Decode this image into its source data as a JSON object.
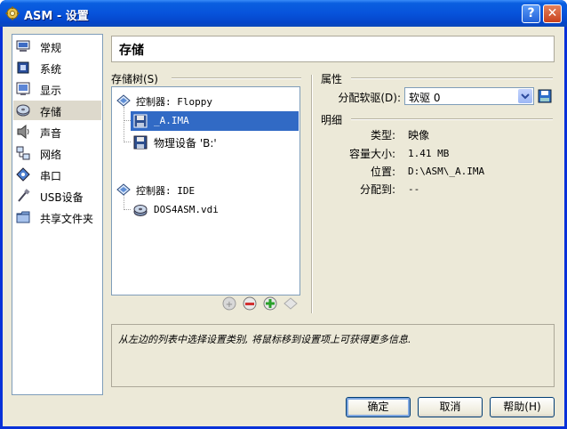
{
  "window": {
    "title": "ASM - 设置"
  },
  "titlebar_buttons": {
    "help": "?",
    "close": "✕"
  },
  "nav": {
    "items": [
      {
        "label": "常规",
        "icon": "monitor-icon"
      },
      {
        "label": "系统",
        "icon": "chip-icon"
      },
      {
        "label": "显示",
        "icon": "display-icon"
      },
      {
        "label": "存储",
        "icon": "disk-icon",
        "selected": true
      },
      {
        "label": "声音",
        "icon": "speaker-icon"
      },
      {
        "label": "网络",
        "icon": "network-icon"
      },
      {
        "label": "串口",
        "icon": "serial-port-icon"
      },
      {
        "label": "USB设备",
        "icon": "usb-icon"
      },
      {
        "label": "共享文件夹",
        "icon": "folder-icon"
      }
    ]
  },
  "page": {
    "title": "存储"
  },
  "storage_tree": {
    "label": "存储树(S)",
    "controller_floppy": "控制器: Floppy",
    "floppy_image": "_A.IMA",
    "floppy_host": "物理设备 'B:'",
    "controller_ide": "控制器: IDE",
    "ide_disk": "DOS4ASM.vdi"
  },
  "attributes": {
    "label": "属性",
    "mount_label": "分配软驱(D):",
    "mount_value": "软驱 0"
  },
  "details": {
    "label": "明细",
    "type_label": "类型:",
    "type_value": "映像",
    "size_label": "容量大小:",
    "size_value": "1.41 MB",
    "location_label": "位置:",
    "location_value": "D:\\ASM\\_A.IMA",
    "attached_label": "分配到:",
    "attached_value": "--"
  },
  "info": {
    "text": "从左边的列表中选择设置类别, 将鼠标移到设置项上可获得更多信息."
  },
  "buttons": {
    "ok": "确定",
    "cancel": "取消",
    "help": "帮助(H)"
  }
}
